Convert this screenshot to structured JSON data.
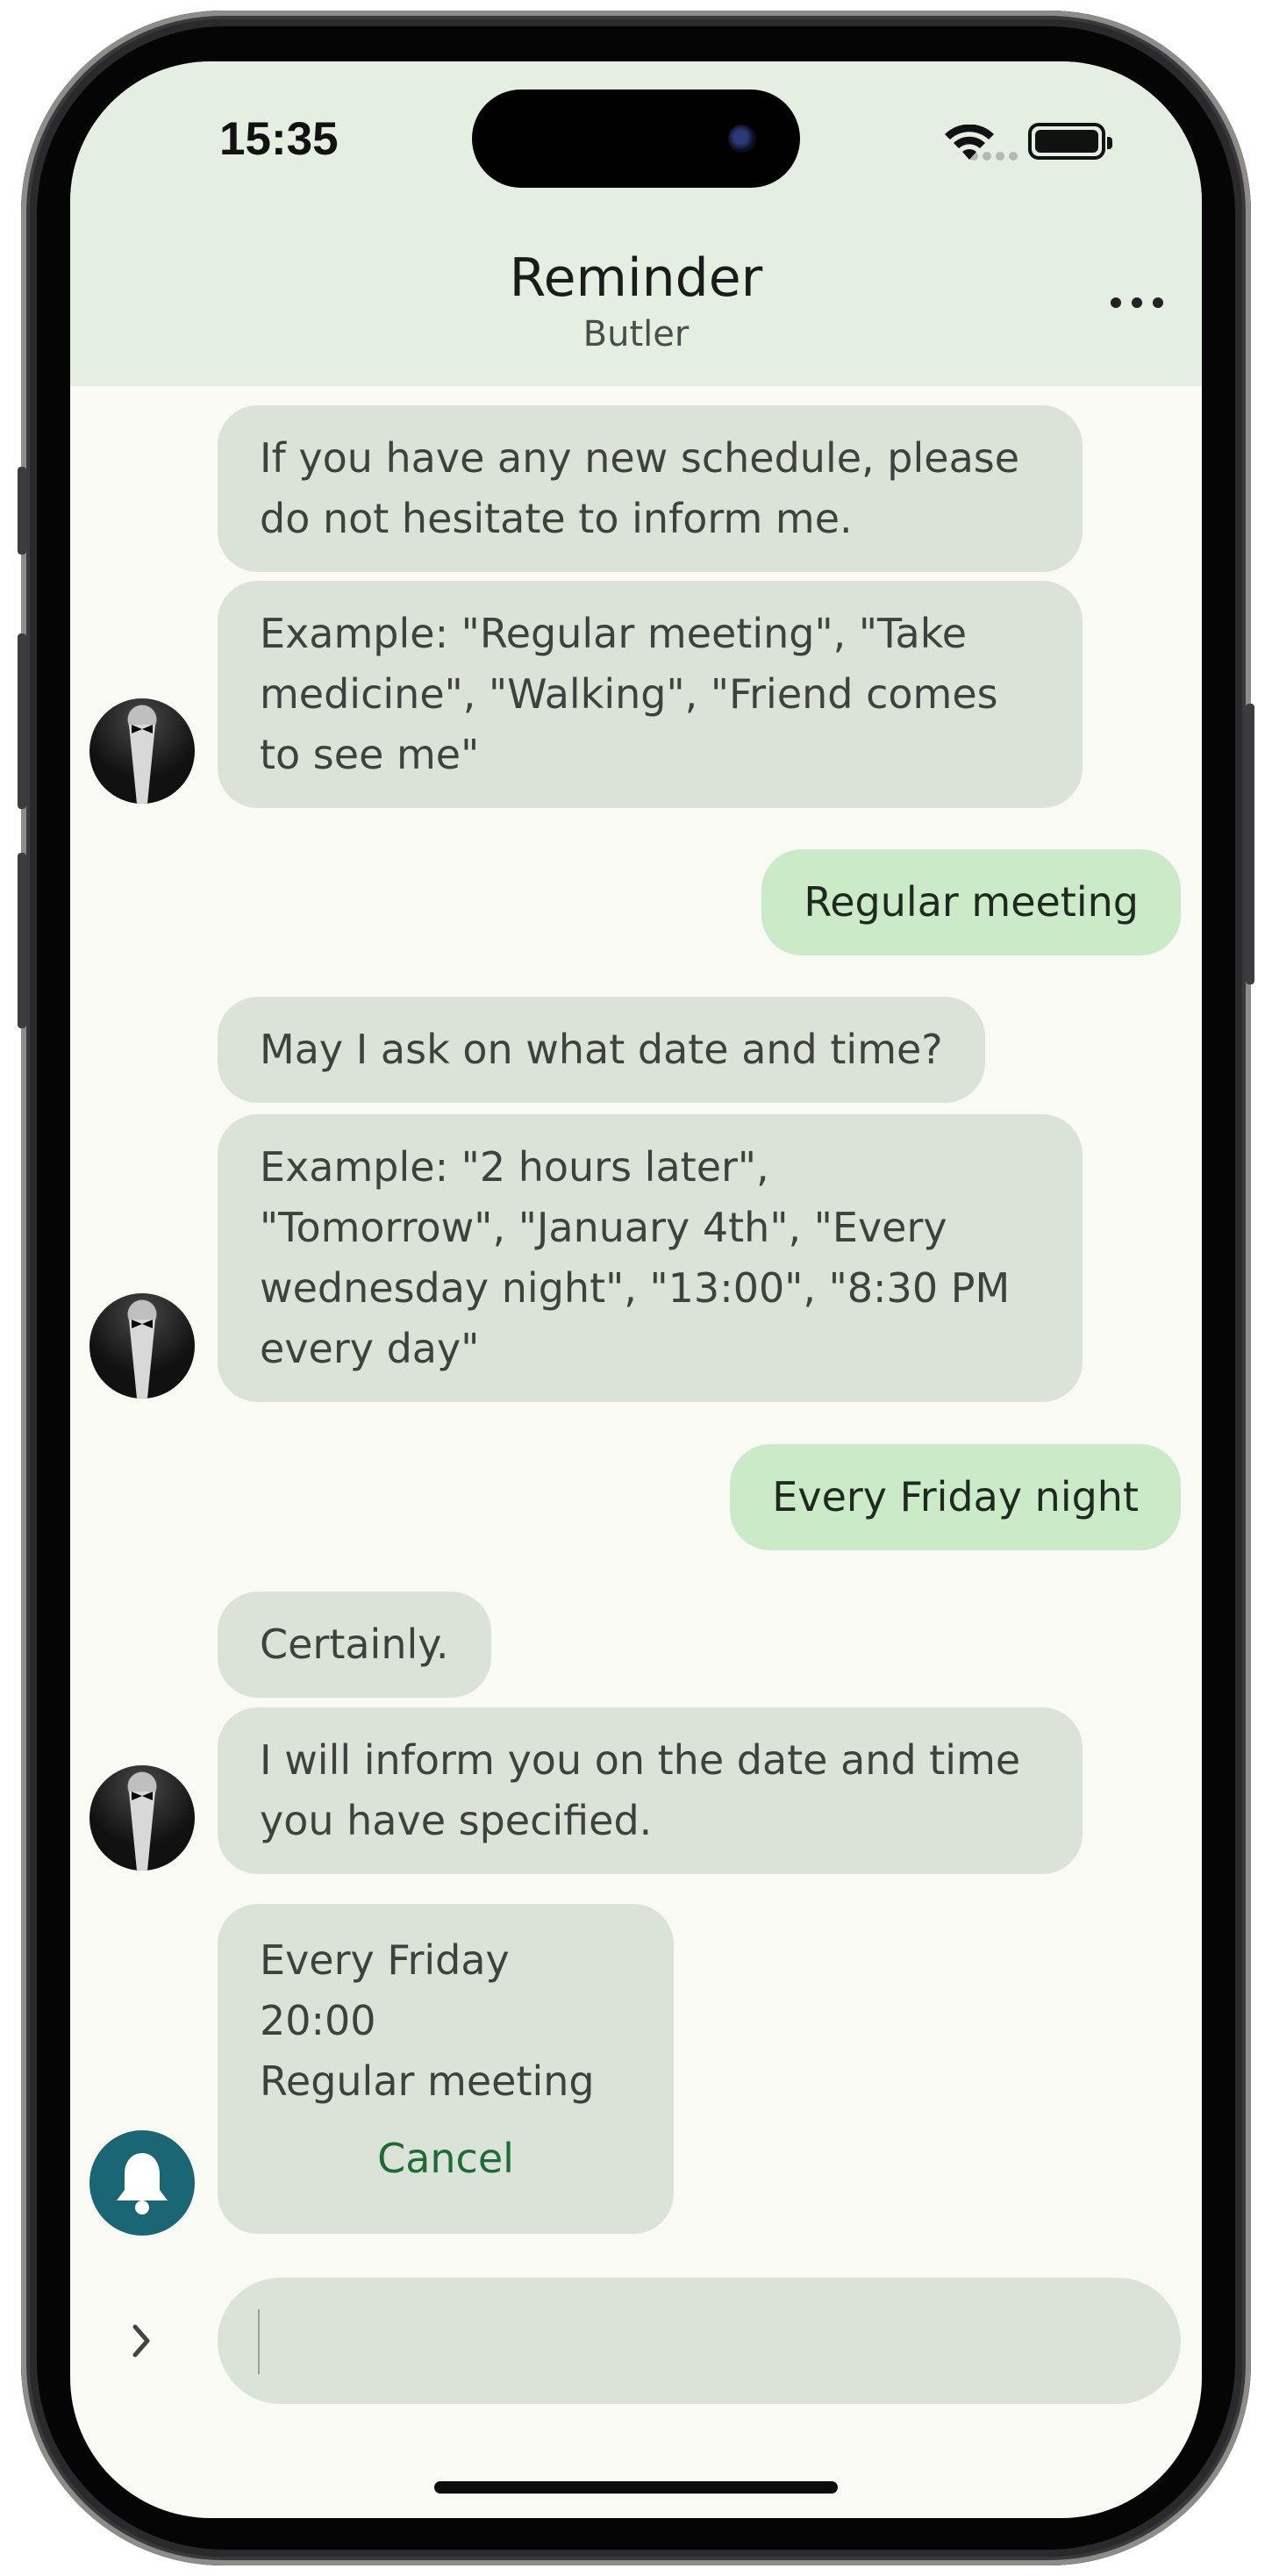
{
  "status_bar": {
    "time": "15:35"
  },
  "header": {
    "title": "Reminder",
    "subtitle": "Butler",
    "more_icon": "more-horizontal-icon"
  },
  "messages": [
    {
      "sender": "bot",
      "text": "If you have any new schedule, please do not hesitate to inform me.",
      "lines": [
        "If you have any new schedule, please",
        "do not hesitate to inform me."
      ]
    },
    {
      "sender": "bot",
      "text": "Example: \"Regular meeting\", \"Take medicine\", \"Walking\", \"Friend comes to see me\"",
      "lines": [
        "Example: \"Regular meeting\", \"Take",
        "medicine\", \"Walking\", \"Friend comes",
        "to see me\""
      ]
    },
    {
      "sender": "user",
      "text": "Regular meeting"
    },
    {
      "sender": "bot",
      "text": "May I ask on what date and time?"
    },
    {
      "sender": "bot",
      "text": "Example: \"2 hours later\", \"Tomorrow\", \"January 4th\", \"Every wednesday night\", \"13:00\", \"8:30 PM every day\"",
      "lines": [
        "Example: \"2 hours later\",",
        "\"Tomorrow\", \"January 4th\", \"Every",
        "wednesday night\", \"13:00\", \"8:30 PM",
        "every day\""
      ]
    },
    {
      "sender": "user",
      "text": "Every Friday night"
    },
    {
      "sender": "bot",
      "text": "Certainly."
    },
    {
      "sender": "bot",
      "text": "I will inform you on the date and time you have specified.",
      "lines": [
        "I will inform you on the date and time",
        "you have specified."
      ]
    }
  ],
  "reminder_card": {
    "schedule": "Every Friday 20:00",
    "title": "Regular meeting",
    "cancel_label": "Cancel"
  },
  "composer": {
    "expand_icon": "chevron-right-icon",
    "value": "",
    "placeholder": ""
  },
  "colors": {
    "header_bg": "#e4efe2",
    "screen_bg": "#f8faf3",
    "bot_bubble": "#dbe3d9",
    "user_bubble": "#cbeac7",
    "accent_green": "#1d6b35",
    "bell_bg": "#1b6674"
  }
}
